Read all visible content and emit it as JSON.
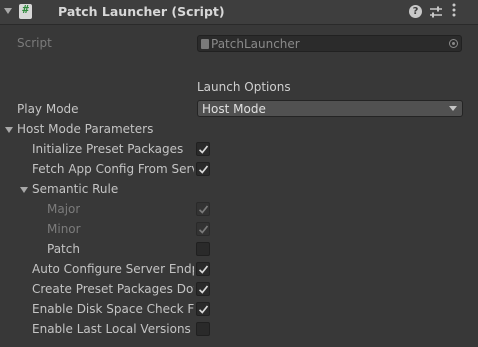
{
  "header": {
    "title": "Patch Launcher (Script)",
    "help_glyph": "?",
    "menu_glyph": "⋮"
  },
  "script_field": {
    "label": "Script",
    "value": "PatchLauncher"
  },
  "launch_options": {
    "heading": "Launch Options",
    "play_mode": {
      "label": "Play Mode",
      "selected": "Host Mode"
    }
  },
  "host_mode_parameters": {
    "label": "Host Mode Parameters",
    "initialize_preset_packages": {
      "label": "Initialize Preset Packages",
      "checked": true
    },
    "fetch_app_config": {
      "label": "Fetch App Config From Serve",
      "checked": true
    },
    "semantic_rule": {
      "label": "Semantic Rule",
      "major": {
        "label": "Major",
        "checked": true,
        "disabled": true
      },
      "minor": {
        "label": "Minor",
        "checked": true,
        "disabled": true
      },
      "patch": {
        "label": "Patch",
        "checked": false,
        "disabled": false
      }
    },
    "auto_configure_server": {
      "label": "Auto Configure Server Endpo",
      "checked": true
    },
    "create_preset_packages": {
      "label": "Create Preset Packages Dow",
      "checked": true
    },
    "enable_disk_space_check": {
      "label": "Enable Disk Space Check Fo",
      "checked": true
    },
    "enable_last_local_versions": {
      "label": "Enable Last Local Versions C",
      "checked": false
    }
  },
  "colors": {
    "background": "#383838",
    "header_background": "#3e3e3e",
    "field_background": "#2b2b2b",
    "dropdown_background": "#515151",
    "text": "#c4c4c4",
    "text_disabled": "#7b7b7b",
    "checkmark": "#d8d8d8"
  }
}
